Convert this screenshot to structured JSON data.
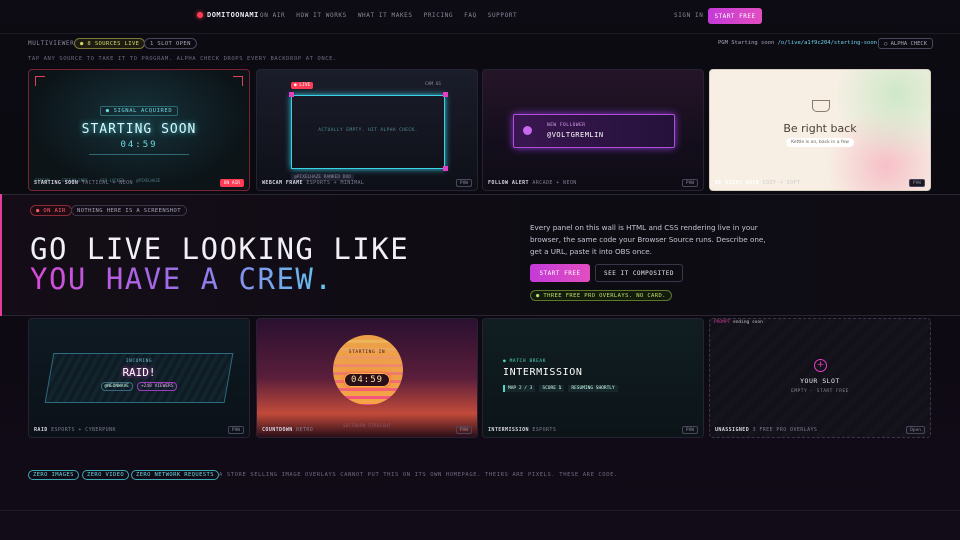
{
  "nav": {
    "brand": "DOMITOONAMI",
    "links": [
      "ON AIR",
      "HOW IT WORKS",
      "WHAT IT MAKES",
      "PRICING",
      "FAQ",
      "SUPPORT"
    ],
    "signin": "SIGN IN",
    "start": "START FREE"
  },
  "multiviewer": {
    "label": "MULTIVIEWER",
    "sources": "● 8 SOURCES LIVE",
    "slot": "1 SLOT OPEN",
    "pgm_label": "PGM Starting soon",
    "pgm_url": "/o/live/a1f9c204/starting-soon",
    "alpha": "○ ALPHA CHECK",
    "hint": "TAP ANY SOURCE TO TAKE IT TO PROGRAM. ALPHA CHECK DROPS EVERY BACKDROP AT ONCE."
  },
  "tiles_top": [
    {
      "name": "STARTING SOON",
      "desc": "TACTICAL + NEON",
      "tag": "ON AIR",
      "signal": "● SIGNAL ACQUIRED",
      "title": "STARTING SOON",
      "timer": "04:59",
      "foot1": "STREAM",
      "foot2": "STREAM ENDS",
      "foot3": "GEO-LOCKED",
      "foot4": "@PIXELHAZE"
    },
    {
      "name": "WEBCAM FRAME",
      "desc": "ESPORTS + MINIMAL",
      "tag": "PVW",
      "live": "● LIVE",
      "cam": "CAM 01",
      "note": "ACTUALLY EMPTY. HIT ALPHA CHECK.",
      "handle": "@PIXELHAZE RANKED DUO"
    },
    {
      "name": "FOLLOW ALERT",
      "desc": "ARCADE + NEON",
      "tag": "PVW",
      "kicker": "NEW FOLLOWER",
      "handle": "@VOLTGREMLIN"
    },
    {
      "name": "BE RIGHT BACK",
      "desc": "COZY + SOFT",
      "tag": "PVW",
      "title": "Be right back",
      "sub": "Kettle is on, back in a few"
    }
  ],
  "hero": {
    "onair": "● ON AIR",
    "note": "NOTHING HERE IS A SCREENSHOT",
    "line1": "GO LIVE LOOKING LIKE",
    "line2": "YOU HAVE A CREW.",
    "desc": "Every panel on this wall is HTML and CSS rendering live in your browser, the same code your Browser Source runs. Describe one, get a URL, paste it into OBS once.",
    "btn1": "START FREE",
    "btn2": "SEE IT COMPOSITED",
    "free": "● THREE FREE PRO OVERLAYS. NO CARD."
  },
  "tiles_bottom": [
    {
      "name": "RAID",
      "desc": "ESPORTS + CYBERPUNK",
      "tag": "PVW",
      "kicker": "INCOMING",
      "title": "RAID!",
      "handle": "@NEONWAVE",
      "viewers": "+248 VIEWERS"
    },
    {
      "name": "COUNTDOWN",
      "desc": "RETRO",
      "tag": "PVW",
      "timer": "04:59",
      "above": "STARTING IN",
      "below": "SOFTBURN STRAIGHT"
    },
    {
      "name": "INTERMISSION",
      "desc": "ESPORTS",
      "tag": "PVW",
      "kicker": "● MATCH BREAK",
      "title": "INTERMISSION",
      "map": "MAP 2 / 3",
      "score_label": "SCORE",
      "score": "1",
      "resume": "RESUMING SHORTLY"
    },
    {
      "name": "UNASSIGNED",
      "desc": "3 FREE PRO OVERLAYS",
      "tag": "Open",
      "prompt": "PROMPT",
      "prompt_text": "ending soon",
      "title": "YOUR SLOT",
      "sub": "EMPTY · START FREE"
    }
  ],
  "footer": {
    "pills": [
      "ZERO IMAGES",
      "ZERO VIDEO",
      "ZERO NETWORK REQUESTS"
    ],
    "note": "A STORE SELLING IMAGE OVERLAYS CANNOT PUT THIS ON ITS OWN HOMEPAGE. THEIRS ARE PIXELS. THESE ARE CODE."
  }
}
